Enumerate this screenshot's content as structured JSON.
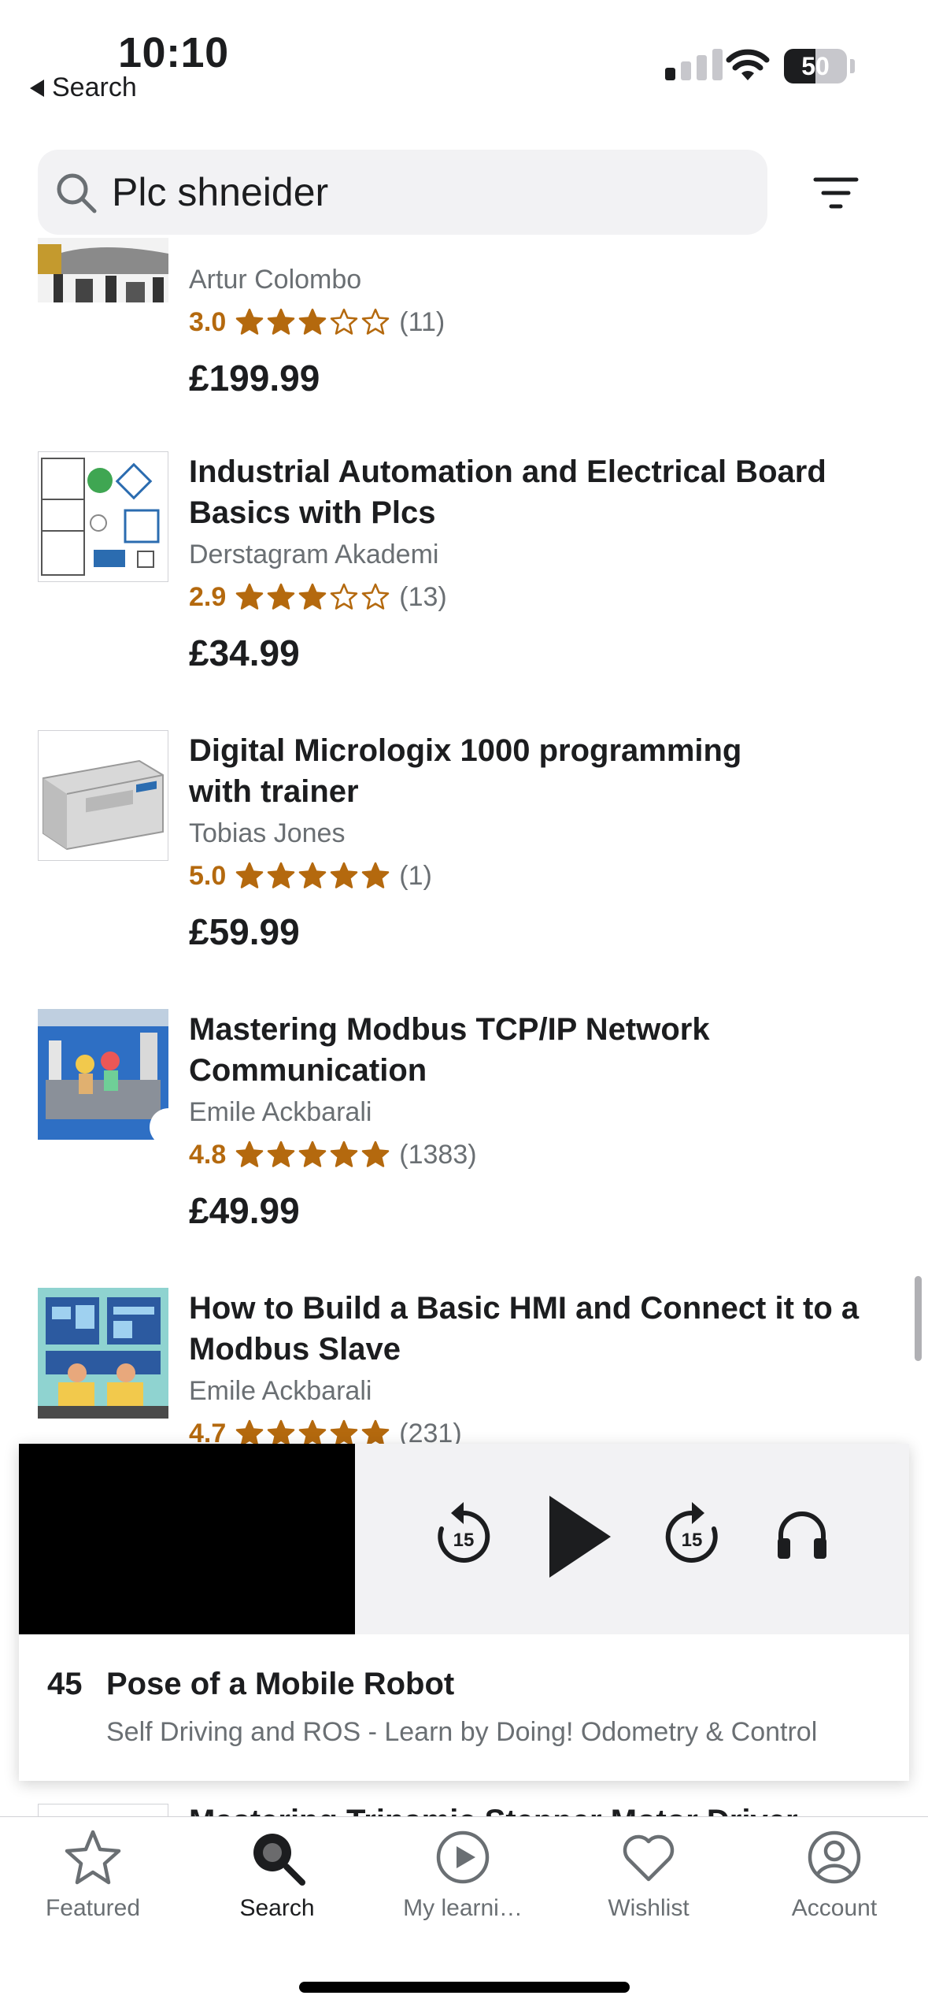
{
  "status_bar": {
    "time": "10:10",
    "back_label": "Search",
    "battery": "50",
    "battery_level": 0.5
  },
  "search": {
    "query": "Plc shneider"
  },
  "courses": [
    {
      "title_lines": [],
      "author": "Artur Colombo",
      "rating": "3.0",
      "stars": 3,
      "count": "(11)",
      "price": "£199.99"
    },
    {
      "title_lines": [
        "Industrial Automation and Electrical Board",
        "Basics with Plcs"
      ],
      "author": "Derstagram Akademi",
      "rating": "2.9",
      "stars": 3,
      "count": "(13)",
      "price": "£34.99"
    },
    {
      "title_lines": [
        "Digital Micrologix 1000 programming",
        "with trainer"
      ],
      "author": "Tobias Jones",
      "rating": "5.0",
      "stars": 5,
      "count": "(1)",
      "price": "£59.99"
    },
    {
      "title_lines": [
        "Mastering Modbus TCP/IP Network",
        "Communication"
      ],
      "author": "Emile Ackbarali",
      "rating": "4.8",
      "stars": 5,
      "count": "(1383)",
      "price": "£49.99"
    },
    {
      "title_lines": [
        "How to Build a Basic HMI and Connect it to a",
        "Modbus Slave"
      ],
      "author": "Emile Ackbarali",
      "rating": "4.7",
      "stars": 5,
      "count": "(231)",
      "price": ""
    }
  ],
  "peek_title": "Mastering Trinamic Stepper Motor Driver",
  "player": {
    "lecture_number": "45",
    "lecture_title": "Pose of a Mobile Robot",
    "course_title": "Self Driving and ROS - Learn by Doing! Odometry & Control",
    "skip_seconds": "15"
  },
  "tabs": [
    {
      "label": "Featured",
      "icon": "star-icon"
    },
    {
      "label": "Search",
      "icon": "search-icon"
    },
    {
      "label": "My learni…",
      "icon": "play-circle-icon"
    },
    {
      "label": "Wishlist",
      "icon": "heart-icon"
    },
    {
      "label": "Account",
      "icon": "account-icon"
    }
  ],
  "colors": {
    "rating": "#b4690e",
    "text": "#1c1d1f",
    "muted": "#6a6f73"
  }
}
